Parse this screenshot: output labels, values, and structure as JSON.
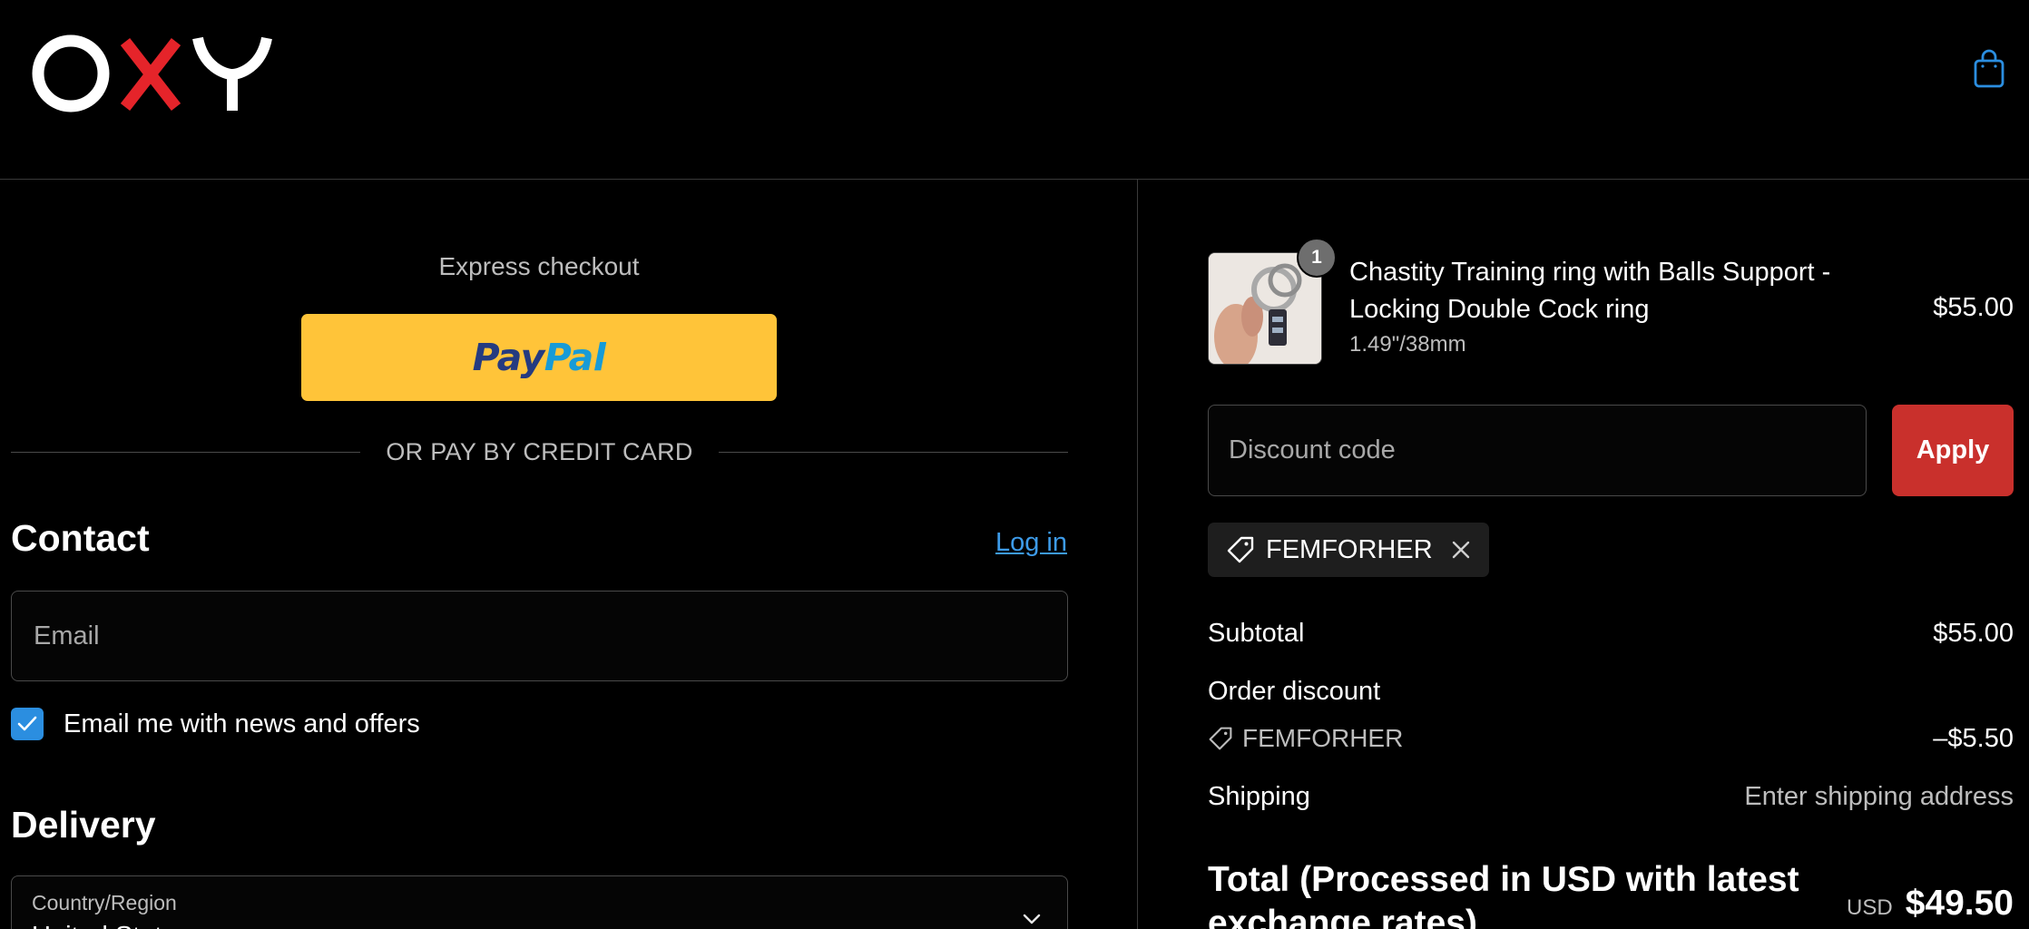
{
  "header": {
    "logo_text": "OXY",
    "cart_icon": "shopping-bag-icon"
  },
  "express": {
    "title": "Express checkout",
    "paypal_label_1": "Pay",
    "paypal_label_2": "Pal",
    "separator": "OR PAY BY CREDIT CARD"
  },
  "contact": {
    "title": "Contact",
    "login_label": "Log in",
    "email_placeholder": "Email",
    "newsletter_label": "Email me with news and offers",
    "newsletter_checked": true
  },
  "delivery": {
    "title": "Delivery",
    "country_label": "Country/Region",
    "country_value": "United States"
  },
  "product": {
    "quantity": "1",
    "name": "Chastity Training ring with Balls Support - Locking Double Cock ring",
    "variant": "1.49\"/38mm",
    "price": "$55.00"
  },
  "discount": {
    "placeholder": "Discount code",
    "apply_label": "Apply",
    "applied_code": "FEMFORHER"
  },
  "summary": {
    "subtotal_label": "Subtotal",
    "subtotal_value": "$55.00",
    "order_discount_label": "Order discount",
    "discount_code": "FEMFORHER",
    "discount_value": "–$5.50",
    "shipping_label": "Shipping",
    "shipping_value": "Enter shipping address",
    "total_label": "Total (Processed in USD with latest exchange rates)",
    "total_currency": "USD",
    "total_value": "$49.50"
  },
  "colors": {
    "background": "#000000",
    "accent_blue": "#2b8ee0",
    "apply_red": "#c9302c",
    "paypal_yellow": "#ffc439",
    "logo_red": "#e5242a"
  }
}
